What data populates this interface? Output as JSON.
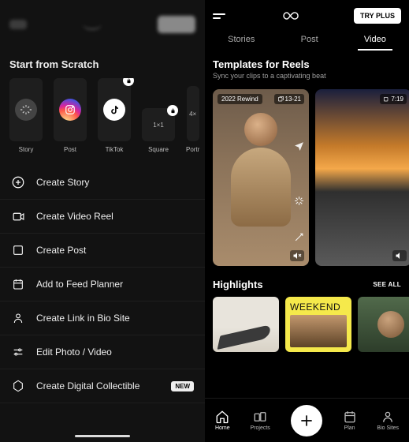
{
  "left": {
    "section_title": "Start from Scratch",
    "tiles": {
      "story": {
        "label": "Story"
      },
      "post": {
        "label": "Post"
      },
      "tiktok": {
        "label": "TikTok"
      },
      "square": {
        "label": "Square",
        "ratio": "1×1"
      },
      "portrait": {
        "label": "Portr",
        "ratio": "4×"
      }
    },
    "rows": {
      "create_story": "Create Story",
      "create_reel": "Create Video Reel",
      "create_post": "Create Post",
      "add_planner": "Add to Feed Planner",
      "link_biosite": "Create Link in Bio Site",
      "edit_media": "Edit Photo / Video",
      "create_nft": "Create Digital Collectible",
      "new_badge": "NEW"
    }
  },
  "right": {
    "try_plus": "TRY PLUS",
    "tabs": {
      "stories": "Stories",
      "post": "Post",
      "video": "Video"
    },
    "reels": {
      "title": "Templates for Reels",
      "subtitle": "Sync your clips to a captivating beat",
      "card1": {
        "tag": "2022 Rewind",
        "duration": "13-21"
      },
      "card2": {
        "duration": "7:19"
      }
    },
    "highlights": {
      "title": "Highlights",
      "see_all": "SEE ALL",
      "weekend": "WEEKEND"
    },
    "nav": {
      "home": "Home",
      "projects": "Projects",
      "plan": "Plan",
      "biosites": "Bio Sites"
    }
  }
}
